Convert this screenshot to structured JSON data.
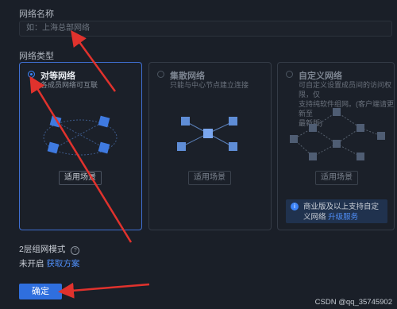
{
  "form": {
    "network_name_label": "网络名称",
    "network_name_placeholder": "如：上海总部网络",
    "network_type_label": "网络类型"
  },
  "cards": [
    {
      "title": "对等网络",
      "desc_lines": [
        "各成员网络可互联"
      ],
      "scene_button": "适用场景",
      "selected": true
    },
    {
      "title": "集散网络",
      "desc_lines": [
        "只能与中心节点建立连接"
      ],
      "scene_button": "适用场景",
      "selected": false
    },
    {
      "title": "自定义网络",
      "desc_lines": [
        "可自定义设置成员间的访问权限，仅",
        "支持纯软件组网。(客户端请更新至",
        "最新版)"
      ],
      "scene_button": "适用场景",
      "selected": false
    }
  ],
  "notice": {
    "text": "商业版及以上支持自定义网络",
    "link": "升级服务"
  },
  "layer2": {
    "label": "2层组网模式",
    "status": "未开启",
    "link": "获取方案"
  },
  "confirm_label": "确定",
  "watermark": "CSDN @qq_35745902",
  "colors": {
    "accent": "#3b82f6",
    "arrow": "#e0322d",
    "background": "#1a1f28"
  }
}
